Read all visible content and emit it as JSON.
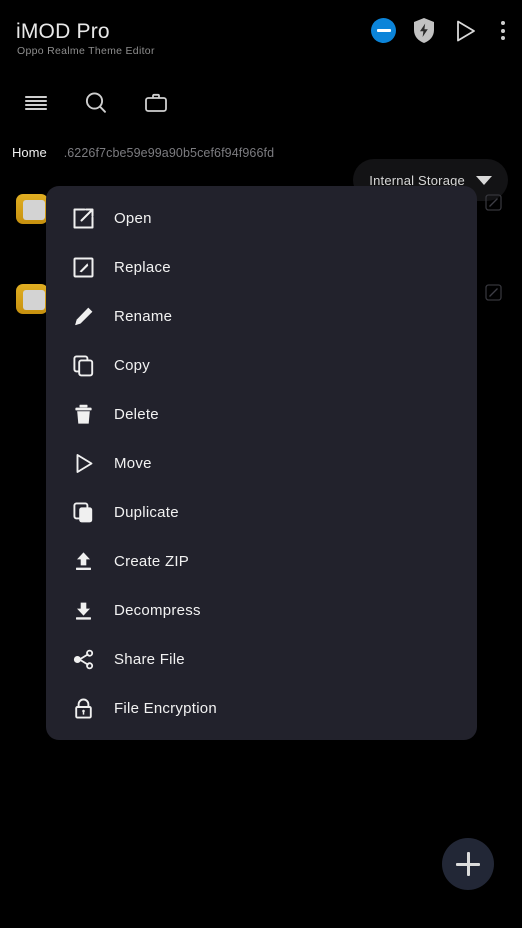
{
  "app": {
    "title": "iMOD Pro",
    "subtitle": "Oppo Realme Theme Editor",
    "header_actions": [
      {
        "name": "minus-circle-icon",
        "label": "minus-circle-icon",
        "color": "#0b84d9"
      },
      {
        "name": "shield-bolt-icon",
        "label": "shield-bolt-icon",
        "color": "#bfbfbf"
      },
      {
        "name": "play-icon",
        "label": "play-icon",
        "color": "#d9d9d9"
      },
      {
        "name": "overflow-menu-icon",
        "label": "overflow-menu-icon",
        "color": "#cfcfcf"
      }
    ]
  },
  "toolbar": {
    "icons": [
      {
        "name": "list-view-icon",
        "label": "list-view-icon"
      },
      {
        "name": "search-icon",
        "label": "search-icon"
      },
      {
        "name": "briefcase-icon",
        "label": "briefcase-icon"
      }
    ],
    "storage": {
      "label": "Internal Storage",
      "caret": "chevron-down-icon"
    }
  },
  "breadcrumb": {
    "home": "Home",
    "path": ".6226f7cbe59e99a90b5cef6f94f966fd"
  },
  "file_list": {
    "rows": [
      {
        "icon": "folder-icon",
        "edit_icon": "edit-box-icon"
      },
      {
        "icon": "folder-icon",
        "edit_icon": "edit-box-icon"
      }
    ]
  },
  "context_menu": {
    "background": "#22222c",
    "items": [
      {
        "label": "Open",
        "icon": "open-external-icon"
      },
      {
        "label": "Replace",
        "icon": "edit-box-icon"
      },
      {
        "label": "Rename",
        "icon": "pencil-icon"
      },
      {
        "label": "Copy",
        "icon": "copy-icon"
      },
      {
        "label": "Delete",
        "icon": "trash-icon"
      },
      {
        "label": "Move",
        "icon": "play-icon"
      },
      {
        "label": "Duplicate",
        "icon": "duplicate-icon"
      },
      {
        "label": "Create ZIP",
        "icon": "upload-icon"
      },
      {
        "label": "Decompress",
        "icon": "download-icon"
      },
      {
        "label": "Share File",
        "icon": "share-icon"
      },
      {
        "label": "File Encryption",
        "icon": "lock-icon"
      }
    ]
  },
  "fab": {
    "label": "add-button",
    "icon": "plus-icon",
    "color": "#222736"
  }
}
